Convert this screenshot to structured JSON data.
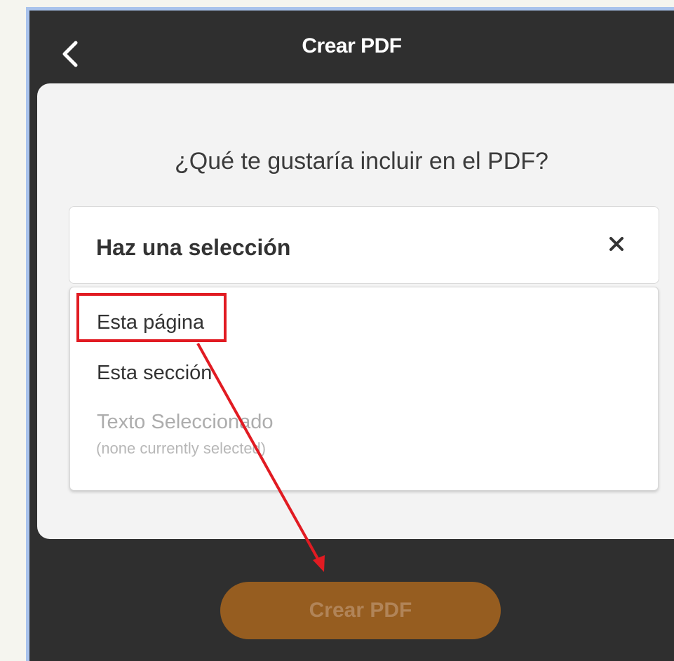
{
  "header": {
    "back_icon": "chevron-left-icon",
    "title": "Crear PDF"
  },
  "main": {
    "question": "¿Qué te gustaría incluir en el PDF?",
    "select": {
      "placeholder": "Haz una selección",
      "clear_icon": "close-icon",
      "options": [
        {
          "label": "Esta página",
          "enabled": true
        },
        {
          "label": "Esta sección",
          "enabled": true
        },
        {
          "label": "Texto Seleccionado",
          "enabled": false,
          "note": "(none currently selected)"
        }
      ]
    }
  },
  "footer": {
    "create_button_label": "Crear PDF"
  },
  "colors": {
    "header_bg": "#2f2f2f",
    "card_bg": "#f3f3f3",
    "button_bg": "#965d20",
    "button_text": "#b18458",
    "annotation": "#e11b22"
  }
}
